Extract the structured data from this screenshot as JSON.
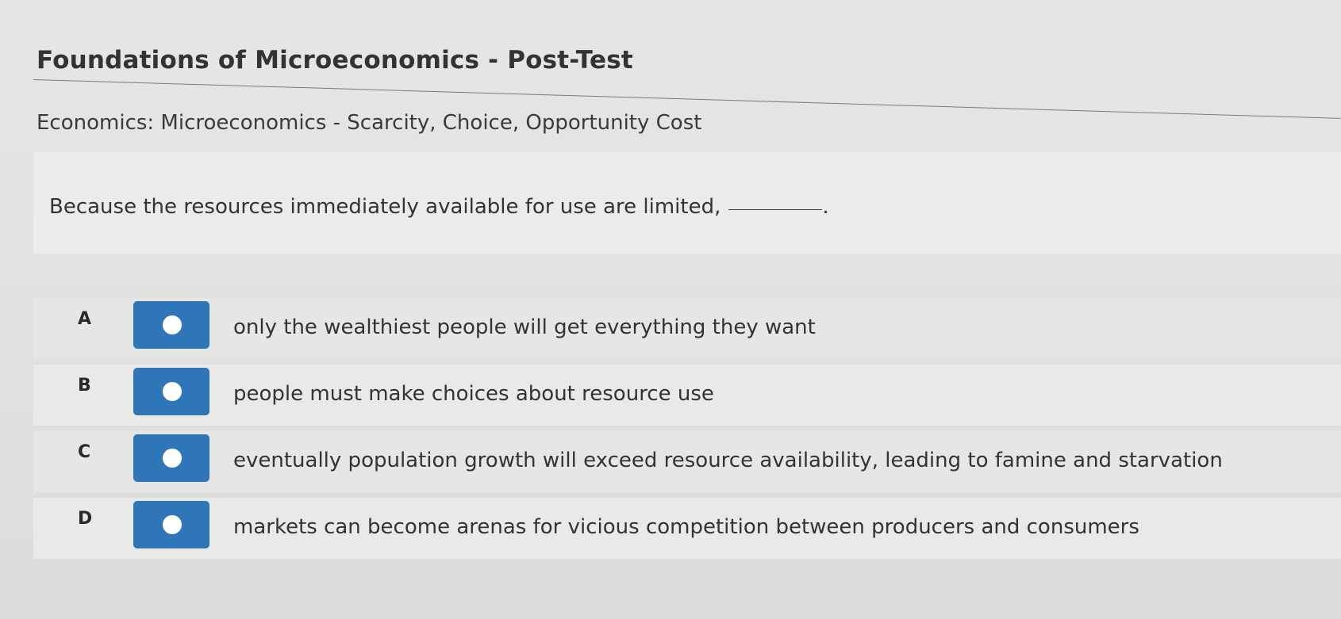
{
  "header": {
    "title": "Foundations of Microeconomics - Post-Test",
    "subtitle": "Economics: Microeconomics - Scarcity, Choice, Opportunity Cost"
  },
  "question": {
    "text": "Because the resources immediately available for use are limited,",
    "end_punctuation": "."
  },
  "options": [
    {
      "letter": "A",
      "text": "only the wealthiest people will get everything they want",
      "selected": false
    },
    {
      "letter": "B",
      "text": "people must make choices about resource use",
      "selected": false
    },
    {
      "letter": "C",
      "text": "eventually population growth will exceed resource availability, leading to famine and starvation",
      "selected": false
    },
    {
      "letter": "D",
      "text": "markets can become arenas for vicious competition between producers and consumers",
      "selected": false
    }
  ],
  "colors": {
    "radio_tile": "#2f76b8",
    "radio_dot": "#ffffff"
  },
  "icons": {
    "radio": "radio-button-icon"
  }
}
